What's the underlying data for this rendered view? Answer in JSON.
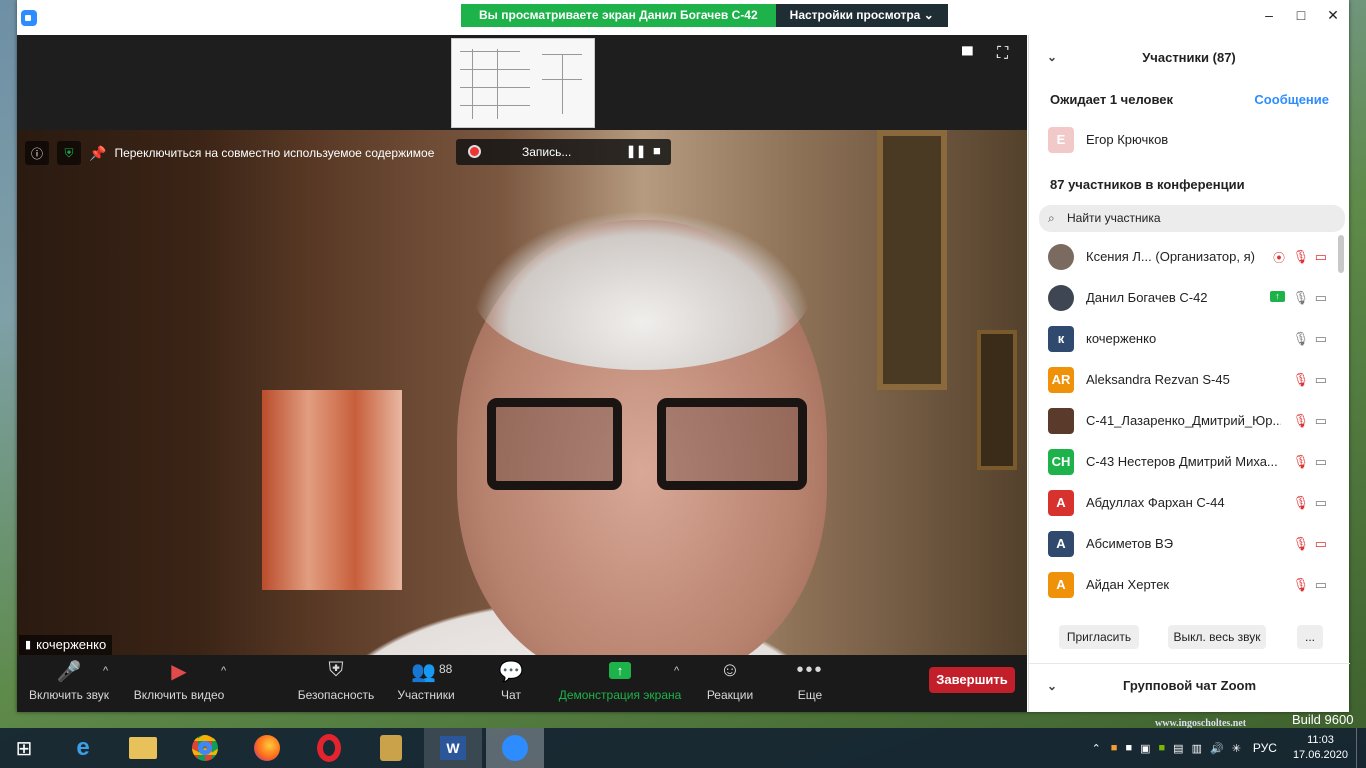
{
  "sharing_banner": {
    "viewing_text": "Вы просматриваете экран Данил Богачев С-42",
    "view_options": "Настройки просмотра"
  },
  "window_controls": {
    "minimize": "–",
    "maximize": "□",
    "close": "✕"
  },
  "stage": {
    "switch_text": "Переключиться на совместно используемое содержимое",
    "recording_text": "Запись...",
    "speaker_name": "кочерженко"
  },
  "toolbar": {
    "mute": "Включить звук",
    "video": "Включить видео",
    "security": "Безопасность",
    "participants": "Участники",
    "participants_count": "88",
    "chat": "Чат",
    "share": "Демонстрация экрана",
    "reactions": "Реакции",
    "more": "Еще",
    "end": "Завершить"
  },
  "panel": {
    "title": "Участники (87)",
    "waiting": "Ожидает 1 человек",
    "message": "Сообщение",
    "waiting_user": {
      "initial": "Е",
      "name": "Егор Крючков"
    },
    "in_meeting": "87 участников в конференции",
    "search_placeholder": "Найти участника",
    "participants": [
      {
        "initial": "",
        "name": "Ксения Л...  (Организатор, я)",
        "color": "#7a6a60"
      },
      {
        "initial": "",
        "name": "Данил Богачев С-42",
        "color": "#3d4652"
      },
      {
        "initial": "к",
        "name": "кочерженко",
        "color": "#2f4a6e"
      },
      {
        "initial": "AR",
        "name": "Aleksandra Rezvan S-45",
        "color": "#f0910a"
      },
      {
        "initial": "",
        "name": "С-41_Лазаренко_Дмитрий_Юр...",
        "color": "#5a3a2a"
      },
      {
        "initial": "CH",
        "name": "С-43 Нестеров Дмитрий Миха...",
        "color": "#1db24a"
      },
      {
        "initial": "А",
        "name": "Абдуллах Фархан С-44",
        "color": "#d8322f"
      },
      {
        "initial": "А",
        "name": "Абсиметов ВЭ",
        "color": "#2f4a6e"
      },
      {
        "initial": "А",
        "name": "Айдан Хертек",
        "color": "#f0910a"
      }
    ],
    "invite": "Пригласить",
    "mute_all": "Выкл. весь звук",
    "more": "...",
    "chat_title": "Групповой чат Zoom"
  },
  "taskbar": {
    "lang": "РУС",
    "time": "11:03",
    "date": "17.06.2020",
    "watermark": "www.ingoscholtes.net",
    "build": "Build 9600"
  },
  "colors": {
    "accent": "#2d8cff",
    "share_green": "#1db24a",
    "end_red": "#c21f2a"
  }
}
